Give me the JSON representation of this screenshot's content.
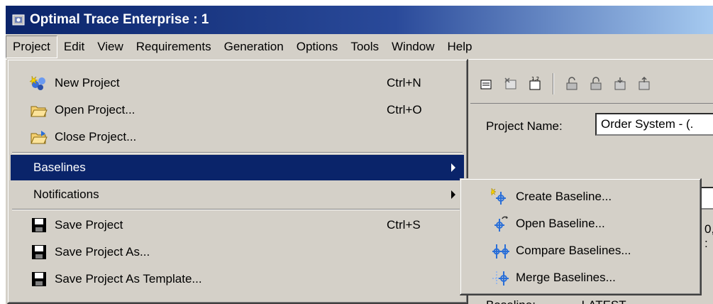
{
  "window": {
    "title": "Optimal Trace Enterprise : 1"
  },
  "menubar": {
    "items": [
      "Project",
      "Edit",
      "View",
      "Requirements",
      "Generation",
      "Options",
      "Tools",
      "Window",
      "Help"
    ]
  },
  "project_menu": {
    "items": [
      {
        "label": "New Project",
        "shortcut": "Ctrl+N",
        "icon": "new-project-icon"
      },
      {
        "label": "Open Project...",
        "shortcut": "Ctrl+O",
        "icon": "open-folder-icon"
      },
      {
        "label": "Close Project...",
        "shortcut": "",
        "icon": "close-folder-icon"
      },
      {
        "label": "Baselines",
        "shortcut": "",
        "submenu": true
      },
      {
        "label": "Notifications",
        "shortcut": "",
        "submenu": true
      },
      {
        "label": "Save Project",
        "shortcut": "Ctrl+S",
        "icon": "floppy-disk-icon"
      },
      {
        "label": "Save Project As...",
        "shortcut": "",
        "icon": "floppy-disk-icon"
      },
      {
        "label": "Save Project As Template...",
        "shortcut": "",
        "icon": "floppy-disk-icon"
      }
    ]
  },
  "baselines_menu": {
    "items": [
      {
        "label": "Create Baseline...",
        "icon": "create-baseline-icon"
      },
      {
        "label": "Open Baseline...",
        "icon": "open-baseline-icon"
      },
      {
        "label": "Compare Baselines...",
        "icon": "compare-baselines-icon"
      },
      {
        "label": "Merge Baselines...",
        "icon": "merge-baselines-icon"
      }
    ]
  },
  "form": {
    "project_name_label": "Project Name:",
    "project_name_value": "Order System - (.",
    "partial_text": "0, :",
    "baseline_label": "Baseline:",
    "baseline_value": "LATEST"
  },
  "colors": {
    "selection": "#0a246a",
    "titlebar_start": "#0a246a",
    "titlebar_end": "#a6caf0",
    "face": "#d4d0c8"
  }
}
